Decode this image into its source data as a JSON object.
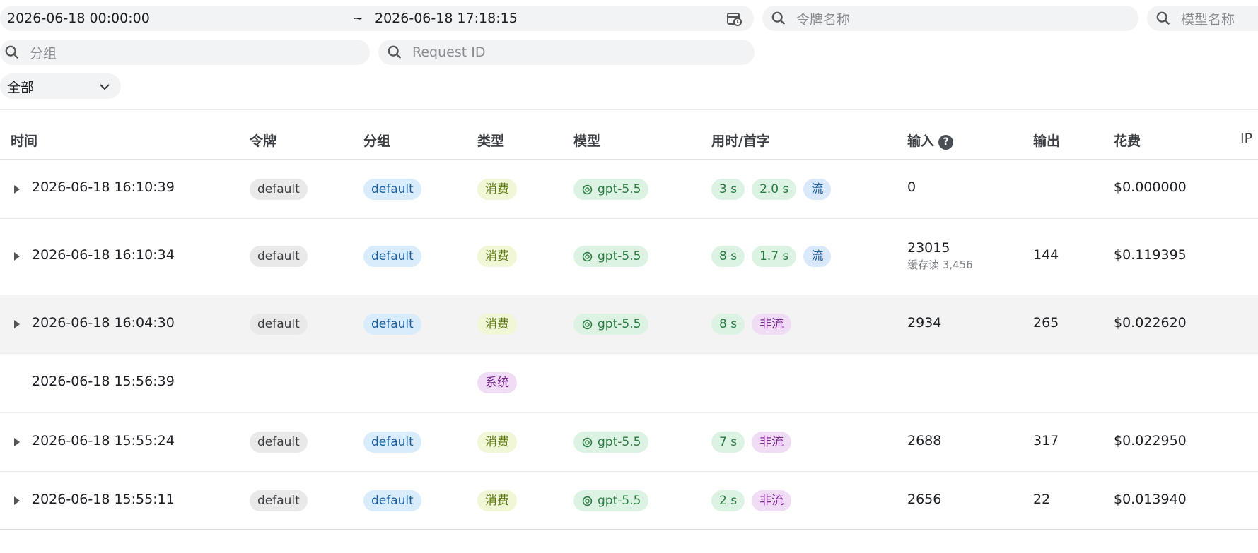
{
  "filters": {
    "start_time": "2026-06-18 00:00:00",
    "range_sep": "~",
    "end_time": "2026-06-18 17:18:15",
    "token_placeholder": "令牌名称",
    "model_placeholder": "模型名称",
    "group_placeholder": "分组",
    "request_id_placeholder": "Request ID",
    "type_select": "全部"
  },
  "columns": {
    "time": "时间",
    "token": "令牌",
    "group": "分组",
    "type": "类型",
    "model": "模型",
    "timing": "用时/首字",
    "input": "输入",
    "output": "输出",
    "cost": "花费",
    "ip": "IP"
  },
  "rows": [
    {
      "time": "2026-06-18 16:10:39",
      "token": "default",
      "group": "default",
      "type": "消费",
      "model": "gpt-5.5",
      "duration": "3 s",
      "first": "2.0 s",
      "mode": "流",
      "input": "0",
      "cache": "",
      "output": "",
      "cost": "$0.000000"
    },
    {
      "time": "2026-06-18 16:10:34",
      "token": "default",
      "group": "default",
      "type": "消费",
      "model": "gpt-5.5",
      "duration": "8 s",
      "first": "1.7 s",
      "mode": "流",
      "input": "23015",
      "cache": "缓存读 3,456",
      "output": "144",
      "cost": "$0.119395"
    },
    {
      "time": "2026-06-18 16:04:30",
      "token": "default",
      "group": "default",
      "type": "消费",
      "model": "gpt-5.5",
      "duration": "8 s",
      "first": "",
      "mode": "非流",
      "input": "2934",
      "cache": "",
      "output": "265",
      "cost": "$0.022620"
    },
    {
      "time": "2026-06-18 15:56:39",
      "token": "",
      "group": "",
      "type": "系统",
      "model": "",
      "duration": "",
      "first": "",
      "mode": "",
      "input": "",
      "cache": "",
      "output": "",
      "cost": ""
    },
    {
      "time": "2026-06-18 15:55:24",
      "token": "default",
      "group": "default",
      "type": "消费",
      "model": "gpt-5.5",
      "duration": "7 s",
      "first": "",
      "mode": "非流",
      "input": "2688",
      "cache": "",
      "output": "317",
      "cost": "$0.022950"
    },
    {
      "time": "2026-06-18 15:55:11",
      "token": "default",
      "group": "default",
      "type": "消费",
      "model": "gpt-5.5",
      "duration": "2 s",
      "first": "",
      "mode": "非流",
      "input": "2656",
      "cache": "",
      "output": "22",
      "cost": "$0.013940"
    }
  ],
  "icons": {
    "search": "search-icon",
    "calendar": "calendar-icon",
    "chevron": "chevron-down-icon",
    "expand": "caret-right-icon",
    "help": "help-icon",
    "model": "openai-icon"
  }
}
